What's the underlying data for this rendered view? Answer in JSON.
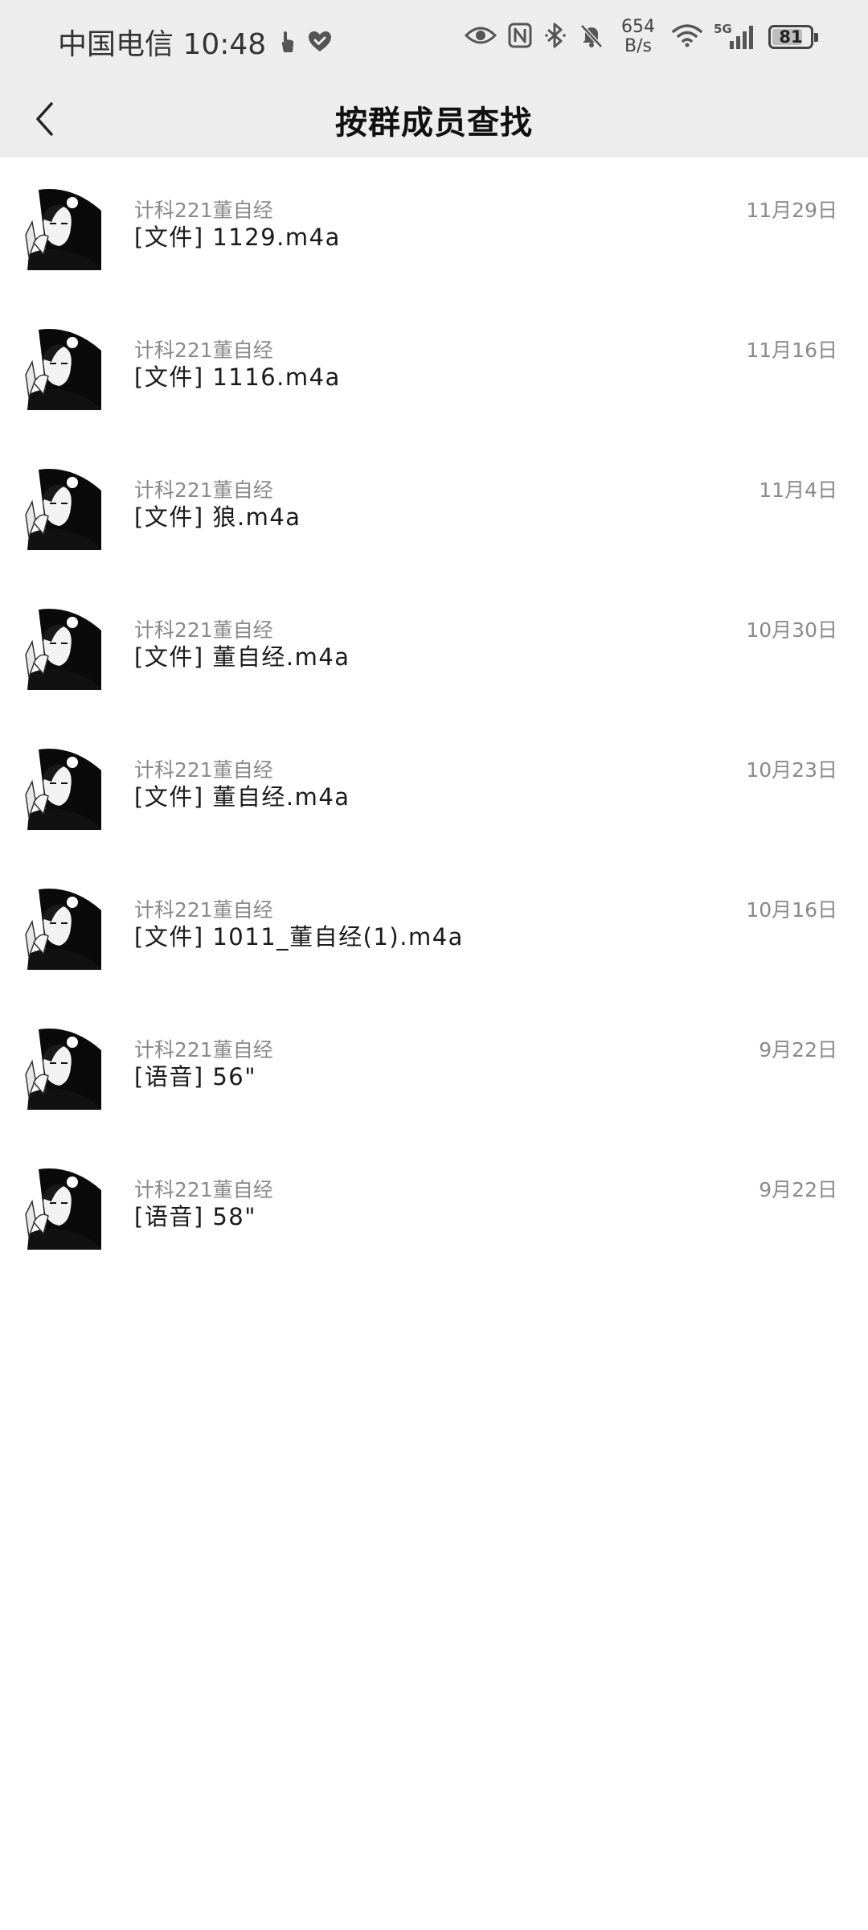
{
  "status_bar": {
    "carrier_time": "中国电信 10:48",
    "net_speed_value": "654",
    "net_speed_unit": "B/s",
    "network_type": "5G",
    "battery_level": "81",
    "battery_fraction": 0.81
  },
  "header": {
    "title": "按群成员查找"
  },
  "messages": [
    {
      "sender": "计科221董自经",
      "content": "[文件] 1129.m4a",
      "date": "11月29日"
    },
    {
      "sender": "计科221董自经",
      "content": "[文件] 1116.m4a",
      "date": "11月16日"
    },
    {
      "sender": "计科221董自经",
      "content": "[文件] 狼.m4a",
      "date": "11月4日"
    },
    {
      "sender": "计科221董自经",
      "content": "[文件] 董自经.m4a",
      "date": "10月30日"
    },
    {
      "sender": "计科221董自经",
      "content": "[文件] 董自经.m4a",
      "date": "10月23日"
    },
    {
      "sender": "计科221董自经",
      "content": "[文件] 1011_董自经(1).m4a",
      "date": "10月16日"
    },
    {
      "sender": "计科221董自经",
      "content": "[语音] 56\"",
      "date": "9月22日"
    },
    {
      "sender": "计科221董自经",
      "content": "[语音] 58\"",
      "date": "9月22日"
    }
  ]
}
